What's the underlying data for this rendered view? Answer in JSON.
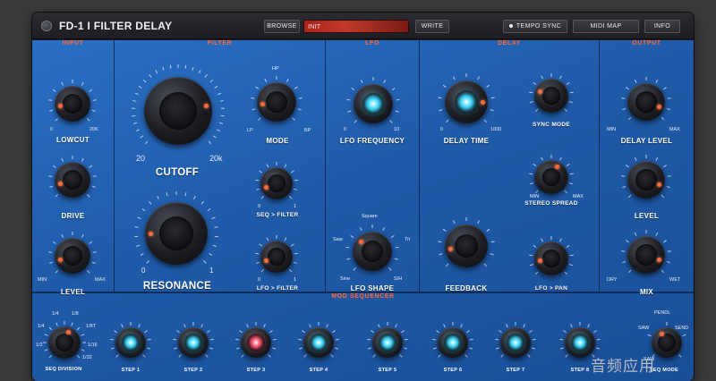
{
  "header": {
    "title": "FD-1 I FILTER DELAY",
    "browse_label": "BROWSE",
    "preset_name": "INIT",
    "write_label": "WRITE",
    "tempo_sync_label": "TEMPO SYNC",
    "midi_map_label": "MIDI MAP",
    "info_label": "INFO"
  },
  "sections": {
    "input": "INPUT",
    "filter": "FILTER",
    "lfo": "LFO",
    "delay": "DELAY",
    "output": "OUTPUT",
    "mod_sequencer": "MOD SEQUENCER"
  },
  "input": {
    "lowcut_label": "LOWCUT",
    "lowcut_min": "0",
    "lowcut_max": "20K",
    "drive_label": "DRIVE",
    "level_label": "LEVEL",
    "level_min": "MIN",
    "level_max": "MAX"
  },
  "filter": {
    "cutoff_label": "CUTOFF",
    "cutoff_min": "20",
    "cutoff_max": "20k",
    "resonance_label": "RESONANCE",
    "resonance_min": "0",
    "resonance_max": "1",
    "mode_label": "MODE",
    "mode_hp": "HP",
    "mode_lp": "LP",
    "mode_bp": "BP",
    "seq_filter_label": "SEQ > FILTER",
    "lfo_filter_label": "LFO > FILTER",
    "seq_filter_min": "0",
    "seq_filter_max": "1",
    "lfo_filter_min": "0",
    "lfo_filter_max": "1"
  },
  "lfo": {
    "frequency_label": "LFO FREQUENCY",
    "frequency_min": "0",
    "frequency_max": "10",
    "shape_label": "LFO SHAPE",
    "shape_square": "Square",
    "shape_saw": "Saw",
    "shape_tri": "Tri",
    "shape_sine": "Sine",
    "shape_sh": "S/H"
  },
  "delay": {
    "time_label": "DELAY TIME",
    "time_min": "0",
    "time_max": "1000",
    "sync_mode_label": "SYNC MODE",
    "stereo_spread_label": "STEREO SPREAD",
    "stereo_spread_min": "MIN",
    "stereo_spread_max": "MAX",
    "feedback_label": "FEEDBACK",
    "lfo_pan_label": "LFO > PAN"
  },
  "output": {
    "delay_level_label": "DELAY LEVEL",
    "delay_level_min": "MIN",
    "delay_level_max": "MAX",
    "level_label": "LEVEL",
    "mix_label": "MIX",
    "mix_min": "DRY",
    "mix_max": "WET"
  },
  "sequencer": {
    "division_label": "SEQ DIVISION",
    "division_marks": [
      "1/4",
      "1/4",
      "1/8",
      "1/8T",
      "1/16",
      "1/32",
      "1/2"
    ],
    "mode_label": "SEQ MODE",
    "mode_marks": [
      "PENDL",
      "SAW",
      "SEND",
      "SAW"
    ],
    "steps": [
      {
        "label": "STEP 1",
        "color": "#3ad6ff"
      },
      {
        "label": "STEP 2",
        "color": "#3ad6ff"
      },
      {
        "label": "STEP 3",
        "color": "#ff4d6d"
      },
      {
        "label": "STEP 4",
        "color": "#3ad6ff"
      },
      {
        "label": "STEP 5",
        "color": "#3ad6ff"
      },
      {
        "label": "STEP 6",
        "color": "#3ad6ff"
      },
      {
        "label": "STEP 7",
        "color": "#3ad6ff"
      },
      {
        "label": "STEP 8",
        "color": "#3ad6ff"
      }
    ]
  },
  "colors": {
    "accent": "#ff6a3c",
    "panel_blue": "#2466b8",
    "led_cyan": "#3ad6ff",
    "led_red": "#ff4d6d"
  },
  "watermark": "音频应用"
}
